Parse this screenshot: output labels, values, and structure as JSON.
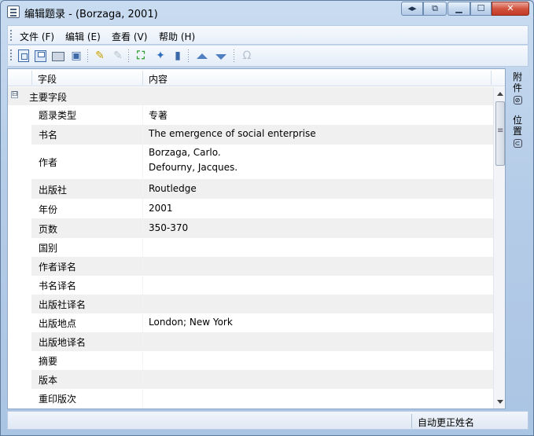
{
  "window": {
    "title": "编辑题录 - (Borzaga, 2001)"
  },
  "caption": {
    "nav": "◂▸",
    "dock": "⧉",
    "min": "▁",
    "max": "☐",
    "close": "✕"
  },
  "menu": [
    "文件 (F)",
    "编辑 (E)",
    "查看 (V)",
    "帮助 (H)"
  ],
  "toolbar": {
    "omega": "Ω"
  },
  "table": {
    "headers": {
      "field": "字段",
      "content": "内容"
    },
    "group": {
      "label": "主要字段",
      "expander": "⊟"
    },
    "rows": [
      {
        "field": "题录类型",
        "value": "专著"
      },
      {
        "field": "书名",
        "value": "The emergence of social enterprise"
      },
      {
        "field": "作者",
        "value": "Borzaga, Carlo.",
        "value2": "Defourny, Jacques."
      },
      {
        "field": "出版社",
        "value": "Routledge"
      },
      {
        "field": "年份",
        "value": "2001"
      },
      {
        "field": "页数",
        "value": "350-370"
      },
      {
        "field": "国别",
        "value": ""
      },
      {
        "field": "作者译名",
        "value": ""
      },
      {
        "field": "书名译名",
        "value": ""
      },
      {
        "field": "出版社译名",
        "value": ""
      },
      {
        "field": "出版地点",
        "value": "London; New York"
      },
      {
        "field": "出版地译名",
        "value": ""
      },
      {
        "field": "摘要",
        "value": ""
      },
      {
        "field": "版本",
        "value": ""
      },
      {
        "field": "重印版次",
        "value": ""
      }
    ]
  },
  "side_tabs": [
    {
      "label_top": "附",
      "label_bottom": "件",
      "icon": "⊘"
    },
    {
      "label_top": "位",
      "label_bottom": "置",
      "icon": "⊂"
    }
  ],
  "status": {
    "text": "自动更正姓名"
  }
}
